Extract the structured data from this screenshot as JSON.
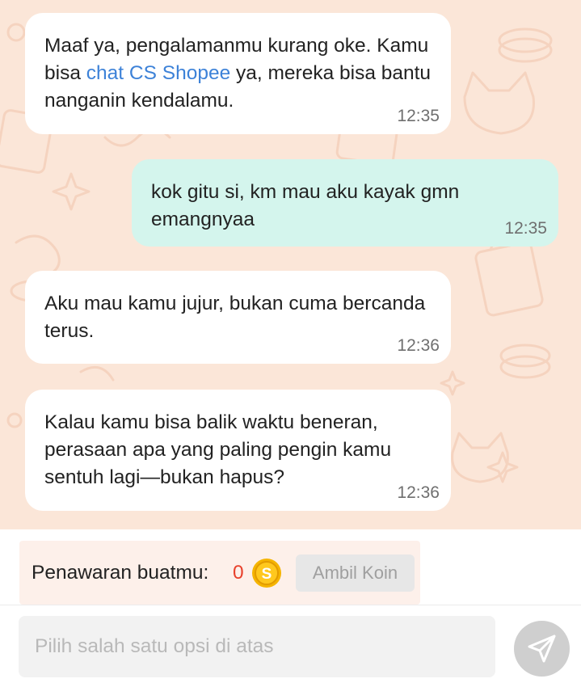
{
  "messages": [
    {
      "sender": "bot",
      "text_before": "Maaf ya, pengalamanmu kurang oke. Kamu bisa ",
      "link": "chat CS Shopee",
      "text_after": " ya, mereka bisa bantu nanganin kendalamu.",
      "time": "12:35"
    },
    {
      "sender": "user",
      "text": "kok gitu si, km mau aku kayak gmn emangnyaa",
      "time": "12:35"
    },
    {
      "sender": "bot",
      "text": "Aku mau kamu jujur, bukan cuma bercanda terus.",
      "time": "12:36"
    },
    {
      "sender": "bot",
      "text": "Kalau kamu bisa balik waktu beneran, perasaan apa yang paling pengin kamu sentuh lagi—bukan hapus?",
      "time": "12:36"
    }
  ],
  "offer": {
    "label": "Penawaran buatmu:",
    "count": "0",
    "coin_icon": "shopee-coin-icon",
    "coin_letter": "S",
    "button_label": "Ambil Koin"
  },
  "composer": {
    "placeholder": "Pilih salah satu opsi di atas",
    "send_icon": "send-icon"
  },
  "colors": {
    "chat_background": "#fbe6d8",
    "bot_bubble": "#ffffff",
    "user_bubble": "#d4f5ed",
    "link": "#3d82d8",
    "offer_count": "#e8412c",
    "coin": "#f5b400"
  }
}
